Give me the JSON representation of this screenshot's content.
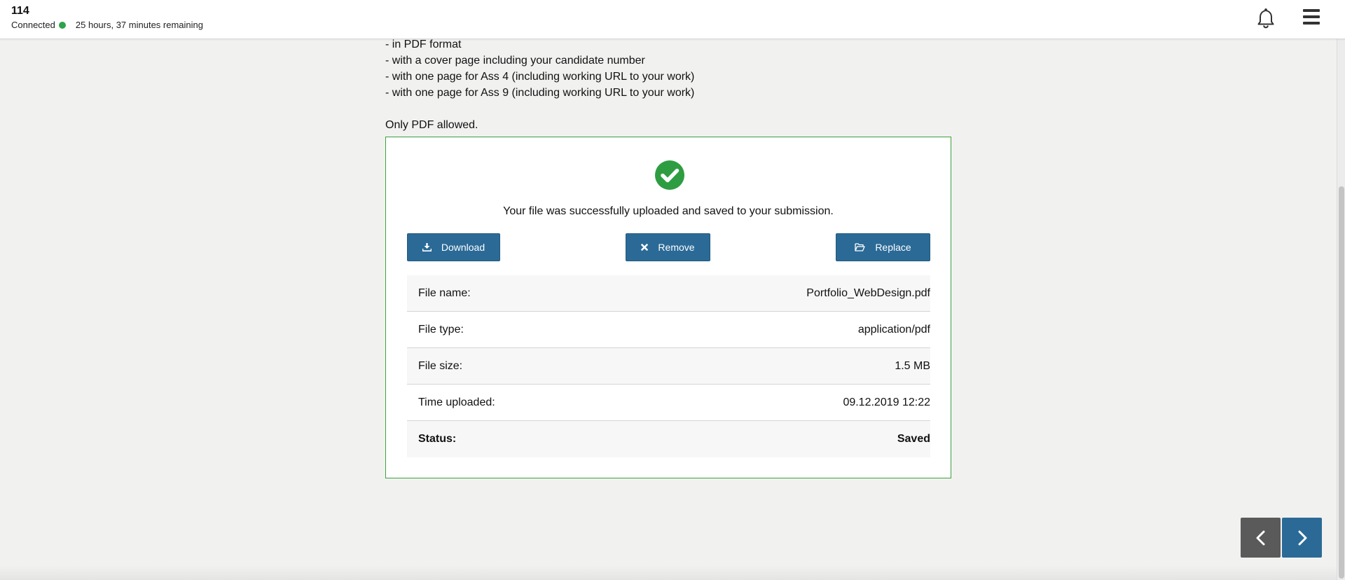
{
  "header": {
    "candidate_number": "114",
    "connection_status": "Connected",
    "connection_color": "#2fa34a",
    "time_remaining": "25 hours, 37 minutes remaining",
    "bell_icon": "bell-icon",
    "menu_icon": "hamburger-menu-icon"
  },
  "instructions": {
    "requirements": [
      "- in PDF format",
      "- with a cover page including your candidate number",
      "- with one page for Ass 4 (including working URL to your work)",
      "- with one page for Ass 9 (including working URL to your work)"
    ],
    "only_pdf": "Only PDF allowed."
  },
  "upload": {
    "success_message": "Your file was successfully uploaded and saved to your submission.",
    "buttons": {
      "download": "Download",
      "remove": "Remove",
      "replace": "Replace"
    },
    "file_info": [
      {
        "label": "File name:",
        "value": "Portfolio_WebDesign.pdf"
      },
      {
        "label": "File type:",
        "value": "application/pdf"
      },
      {
        "label": "File size:",
        "value": "1.5 MB"
      },
      {
        "label": "Time uploaded:",
        "value": "09.12.2019 12:22"
      },
      {
        "label": "Status:",
        "value": "Saved"
      }
    ]
  },
  "navigation": {
    "prev_icon": "chevron-left-icon",
    "next_icon": "chevron-right-icon"
  },
  "colors": {
    "accent": "#2b6a96",
    "success": "#2e9d41",
    "box_border": "#3ca03c"
  }
}
